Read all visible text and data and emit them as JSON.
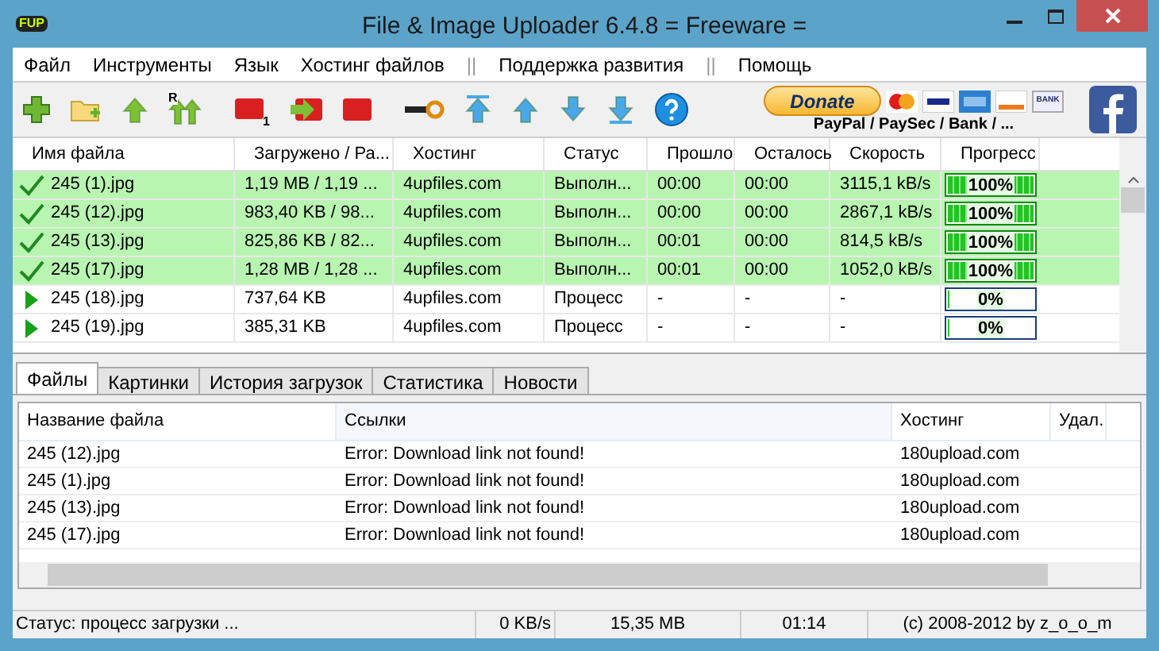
{
  "window": {
    "logo": "FUP",
    "title": "File & Image Uploader 6.4.8  = Freeware ="
  },
  "menu": [
    {
      "label": "Файл",
      "kind": "item"
    },
    {
      "label": "Инструменты",
      "kind": "item"
    },
    {
      "label": "Язык",
      "kind": "item"
    },
    {
      "label": "Хостинг файлов",
      "kind": "item"
    },
    {
      "label": "||",
      "kind": "separator"
    },
    {
      "label": "Поддержка развития",
      "kind": "item"
    },
    {
      "label": "||",
      "kind": "separator"
    },
    {
      "label": "Помощь",
      "kind": "item"
    }
  ],
  "toolbar": {
    "badges": [
      "R",
      "1"
    ],
    "donate": {
      "label": "Donate",
      "caption": "PayPal / PaySec / Bank / ..."
    },
    "cards": [
      "BANK"
    ]
  },
  "uploads": {
    "columns": [
      "Имя файла",
      "Загружено / Ра...",
      "Хостинг",
      "Статус",
      "Прошло",
      "Осталось",
      "Скорость",
      "Прогресс"
    ],
    "rows": [
      {
        "kind": "done",
        "file": "245 (1).jpg",
        "loaded": "1,19 MB / 1,19 ...",
        "host": "4upfiles.com",
        "status": "Выполн...",
        "elapsed": "00:00",
        "remaining": "00:00",
        "speed": "3115,1 kB/s",
        "level": 1,
        "progress": "100%"
      },
      {
        "kind": "done",
        "file": "245 (12).jpg",
        "loaded": "983,40 KB / 98...",
        "host": "4upfiles.com",
        "status": "Выполн...",
        "elapsed": "00:00",
        "remaining": "00:00",
        "speed": "2867,1 kB/s",
        "level": 1,
        "progress": "100%"
      },
      {
        "kind": "done",
        "file": "245 (13).jpg",
        "loaded": "825,86 KB / 82...",
        "host": "4upfiles.com",
        "status": "Выполн...",
        "elapsed": "00:01",
        "remaining": "00:00",
        "speed": "814,5 kB/s",
        "level": 1,
        "progress": "100%"
      },
      {
        "kind": "done",
        "file": "245 (17).jpg",
        "loaded": "1,28 MB / 1,28 ...",
        "host": "4upfiles.com",
        "status": "Выполн...",
        "elapsed": "00:01",
        "remaining": "00:00",
        "speed": "1052,0 kB/s",
        "level": 1,
        "progress": "100%"
      },
      {
        "kind": "running",
        "file": "245 (18).jpg",
        "loaded": "737,64 KB",
        "host": "4upfiles.com",
        "status": "Процесс",
        "elapsed": "-",
        "remaining": "-",
        "speed": "-",
        "level": 0,
        "progress": "0%"
      },
      {
        "kind": "running",
        "file": "245 (19).jpg",
        "loaded": "385,31 KB",
        "host": "4upfiles.com",
        "status": "Процесс",
        "elapsed": "-",
        "remaining": "-",
        "speed": "-",
        "level": 0,
        "progress": "0%"
      }
    ]
  },
  "tabs": [
    {
      "label": "Файлы",
      "selected": true
    },
    {
      "label": "Картинки",
      "selected": false
    },
    {
      "label": "История загрузок",
      "selected": false
    },
    {
      "label": "Статистика",
      "selected": false
    },
    {
      "label": "Новости",
      "selected": false
    }
  ],
  "links": {
    "columns": [
      "Название файла",
      "Ссылки",
      "Хостинг",
      "Удал."
    ],
    "rows": [
      {
        "file": "245 (12).jpg",
        "link": "Error: Download link not found!",
        "host": "180upload.com"
      },
      {
        "file": "245 (1).jpg",
        "link": "Error: Download link not found!",
        "host": "180upload.com"
      },
      {
        "file": "245 (13).jpg",
        "link": "Error: Download link not found!",
        "host": "180upload.com"
      },
      {
        "file": "245 (17).jpg",
        "link": "Error: Download link not found!",
        "host": "180upload.com"
      }
    ]
  },
  "status_bar": [
    "Статус: процесс загрузки ...",
    "0 KB/s",
    "15,35 MB",
    "01:14",
    "(c) 2008-2012 by z_o_o_m"
  ]
}
